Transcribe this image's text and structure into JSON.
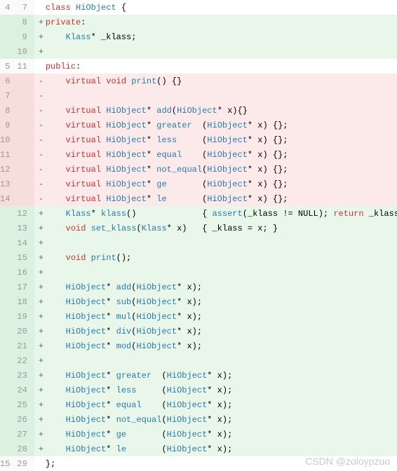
{
  "watermark": "CSDN @zoloypzuo",
  "lines": [
    {
      "old": "4",
      "new": "7",
      "kind": "ctx",
      "marker": " ",
      "code": "<span class='kw'>class</span> <span class='type'>HiObject</span> {"
    },
    {
      "old": "",
      "new": "8",
      "kind": "add",
      "marker": "+",
      "code": "<span class='kw'>private</span>:"
    },
    {
      "old": "",
      "new": "9",
      "kind": "add",
      "marker": "+",
      "code": "    <span class='type'>Klass</span>* _klass;"
    },
    {
      "old": "",
      "new": "10",
      "kind": "add",
      "marker": "+",
      "code": ""
    },
    {
      "old": "5",
      "new": "11",
      "kind": "ctx",
      "marker": " ",
      "code": "<span class='kw'>public</span>:"
    },
    {
      "old": "6",
      "new": "",
      "kind": "del",
      "marker": "-",
      "code": "    <span class='kw'>virtual</span> <span class='kw'>void</span> <span class='type'>print</span>() {}"
    },
    {
      "old": "7",
      "new": "",
      "kind": "del",
      "marker": "-",
      "code": ""
    },
    {
      "old": "8",
      "new": "",
      "kind": "del",
      "marker": "-",
      "code": "    <span class='kw'>virtual</span> <span class='type'>HiObject</span>* <span class='type'>add</span>(<span class='type'>HiObject</span>* x){}"
    },
    {
      "old": "9",
      "new": "",
      "kind": "del",
      "marker": "-",
      "code": "    <span class='kw'>virtual</span> <span class='type'>HiObject</span>* <span class='type'>greater</span>  (<span class='type'>HiObject</span>* x) {};"
    },
    {
      "old": "10",
      "new": "",
      "kind": "del",
      "marker": "-",
      "code": "    <span class='kw'>virtual</span> <span class='type'>HiObject</span>* <span class='type'>less</span>     (<span class='type'>HiObject</span>* x) {};"
    },
    {
      "old": "11",
      "new": "",
      "kind": "del",
      "marker": "-",
      "code": "    <span class='kw'>virtual</span> <span class='type'>HiObject</span>* <span class='type'>equal</span>    (<span class='type'>HiObject</span>* x) {};"
    },
    {
      "old": "12",
      "new": "",
      "kind": "del",
      "marker": "-",
      "code": "    <span class='kw'>virtual</span> <span class='type'>HiObject</span>* <span class='type'>not_equal</span>(<span class='type'>HiObject</span>* x) {};"
    },
    {
      "old": "13",
      "new": "",
      "kind": "del",
      "marker": "-",
      "code": "    <span class='kw'>virtual</span> <span class='type'>HiObject</span>* <span class='type'>ge</span>       (<span class='type'>HiObject</span>* x) {};"
    },
    {
      "old": "14",
      "new": "",
      "kind": "del",
      "marker": "-",
      "code": "    <span class='kw'>virtual</span> <span class='type'>HiObject</span>* <span class='type'>le</span>       (<span class='type'>HiObject</span>* x) {};"
    },
    {
      "old": "",
      "new": "12",
      "kind": "add",
      "marker": "+",
      "code": "    <span class='type'>Klass</span>* <span class='type'>klass</span>()             { <span class='type'>assert</span>(_klass != NULL); <span class='kw'>return</span> _klass; }"
    },
    {
      "old": "",
      "new": "13",
      "kind": "add",
      "marker": "+",
      "code": "    <span class='kw'>void</span> <span class='type'>set_klass</span>(<span class='type'>Klass</span>* x)   { _klass = x; }"
    },
    {
      "old": "",
      "new": "14",
      "kind": "add",
      "marker": "+",
      "code": ""
    },
    {
      "old": "",
      "new": "15",
      "kind": "add",
      "marker": "+",
      "code": "    <span class='kw'>void</span> <span class='type'>print</span>();"
    },
    {
      "old": "",
      "new": "16",
      "kind": "add",
      "marker": "+",
      "code": ""
    },
    {
      "old": "",
      "new": "17",
      "kind": "add",
      "marker": "+",
      "code": "    <span class='type'>HiObject</span>* <span class='type'>add</span>(<span class='type'>HiObject</span>* x);"
    },
    {
      "old": "",
      "new": "18",
      "kind": "add",
      "marker": "+",
      "code": "    <span class='type'>HiObject</span>* <span class='type'>sub</span>(<span class='type'>HiObject</span>* x);"
    },
    {
      "old": "",
      "new": "19",
      "kind": "add",
      "marker": "+",
      "code": "    <span class='type'>HiObject</span>* <span class='type'>mul</span>(<span class='type'>HiObject</span>* x);"
    },
    {
      "old": "",
      "new": "20",
      "kind": "add",
      "marker": "+",
      "code": "    <span class='type'>HiObject</span>* <span class='type'>div</span>(<span class='type'>HiObject</span>* x);"
    },
    {
      "old": "",
      "new": "21",
      "kind": "add",
      "marker": "+",
      "code": "    <span class='type'>HiObject</span>* <span class='type'>mod</span>(<span class='type'>HiObject</span>* x);"
    },
    {
      "old": "",
      "new": "22",
      "kind": "add",
      "marker": "+",
      "code": ""
    },
    {
      "old": "",
      "new": "23",
      "kind": "add",
      "marker": "+",
      "code": "    <span class='type'>HiObject</span>* <span class='type'>greater</span>  (<span class='type'>HiObject</span>* x);"
    },
    {
      "old": "",
      "new": "24",
      "kind": "add",
      "marker": "+",
      "code": "    <span class='type'>HiObject</span>* <span class='type'>less</span>     (<span class='type'>HiObject</span>* x);"
    },
    {
      "old": "",
      "new": "25",
      "kind": "add",
      "marker": "+",
      "code": "    <span class='type'>HiObject</span>* <span class='type'>equal</span>    (<span class='type'>HiObject</span>* x);"
    },
    {
      "old": "",
      "new": "26",
      "kind": "add",
      "marker": "+",
      "code": "    <span class='type'>HiObject</span>* <span class='type'>not_equal</span>(<span class='type'>HiObject</span>* x);"
    },
    {
      "old": "",
      "new": "27",
      "kind": "add",
      "marker": "+",
      "code": "    <span class='type'>HiObject</span>* <span class='type'>ge</span>       (<span class='type'>HiObject</span>* x);"
    },
    {
      "old": "",
      "new": "28",
      "kind": "add",
      "marker": "+",
      "code": "    <span class='type'>HiObject</span>* <span class='type'>le</span>       (<span class='type'>HiObject</span>* x);"
    },
    {
      "old": "15",
      "new": "29",
      "kind": "ctx",
      "marker": " ",
      "code": "};"
    }
  ]
}
